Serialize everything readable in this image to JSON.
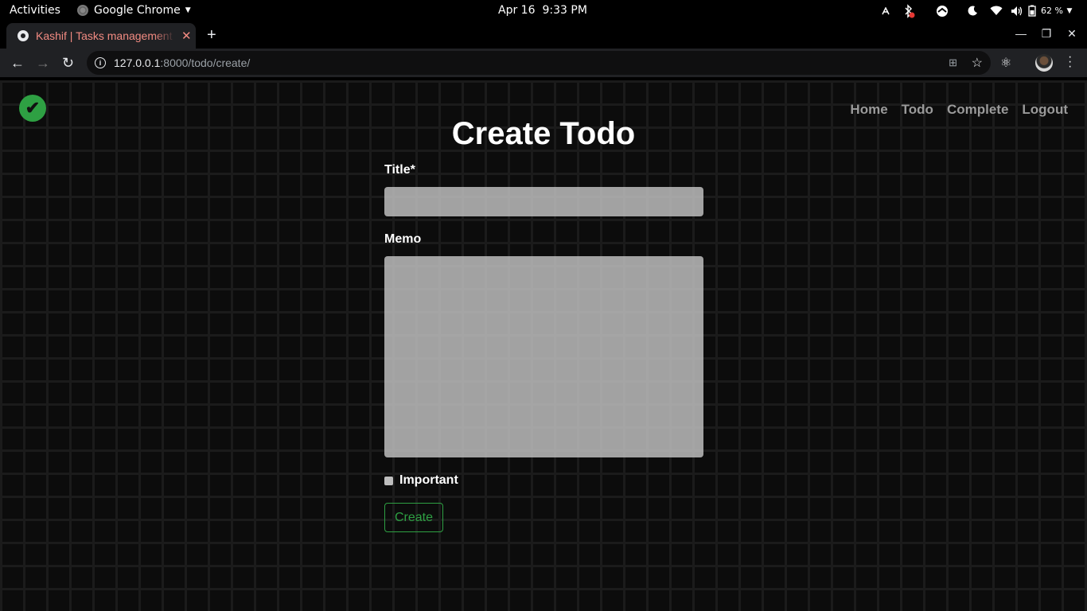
{
  "system_bar": {
    "activities": "Activities",
    "app_name": "Google Chrome",
    "date": "Apr 16",
    "time": "9:33 PM",
    "battery": "62 %"
  },
  "browser": {
    "tab_title": "Kashif | Tasks management",
    "url_host": "127.0.0.1",
    "url_path": ":8000/todo/create/"
  },
  "page": {
    "nav": [
      "Home",
      "Todo",
      "Complete",
      "Logout"
    ],
    "heading": "Create Todo",
    "form": {
      "title_label": "Title*",
      "title_value": "",
      "memo_label": "Memo",
      "memo_value": "",
      "important_label": "Important",
      "important_checked": false,
      "submit_label": "Create"
    }
  },
  "colors": {
    "accent_green": "#2ea043",
    "tab_title": "#f28b82",
    "nav_link": "#9a9a9a"
  }
}
